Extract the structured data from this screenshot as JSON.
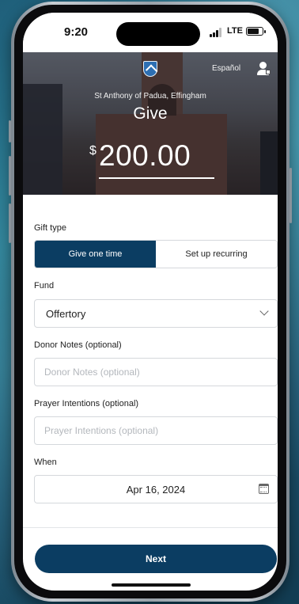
{
  "status_bar": {
    "time": "9:20",
    "network": "LTE",
    "battery_level": 0.8
  },
  "header": {
    "language_link": "Español",
    "parish_name": "St Anthony of Padua, Effingham",
    "title": "Give",
    "currency_symbol": "$",
    "amount": "200.00"
  },
  "form": {
    "gift_type": {
      "label": "Gift type",
      "options": [
        "Give one time",
        "Set up recurring"
      ],
      "selected": "Give one time"
    },
    "fund": {
      "label": "Fund",
      "value": "Offertory"
    },
    "donor_notes": {
      "label": "Donor Notes (optional)",
      "placeholder": "Donor Notes (optional)"
    },
    "prayer_intentions": {
      "label": "Prayer Intentions (optional)",
      "placeholder": "Prayer Intentions (optional)"
    },
    "when": {
      "label": "When",
      "value": "Apr 16, 2024"
    }
  },
  "footer": {
    "next_label": "Next"
  },
  "colors": {
    "primary": "#0b3d62",
    "background": "#2b7f95"
  }
}
